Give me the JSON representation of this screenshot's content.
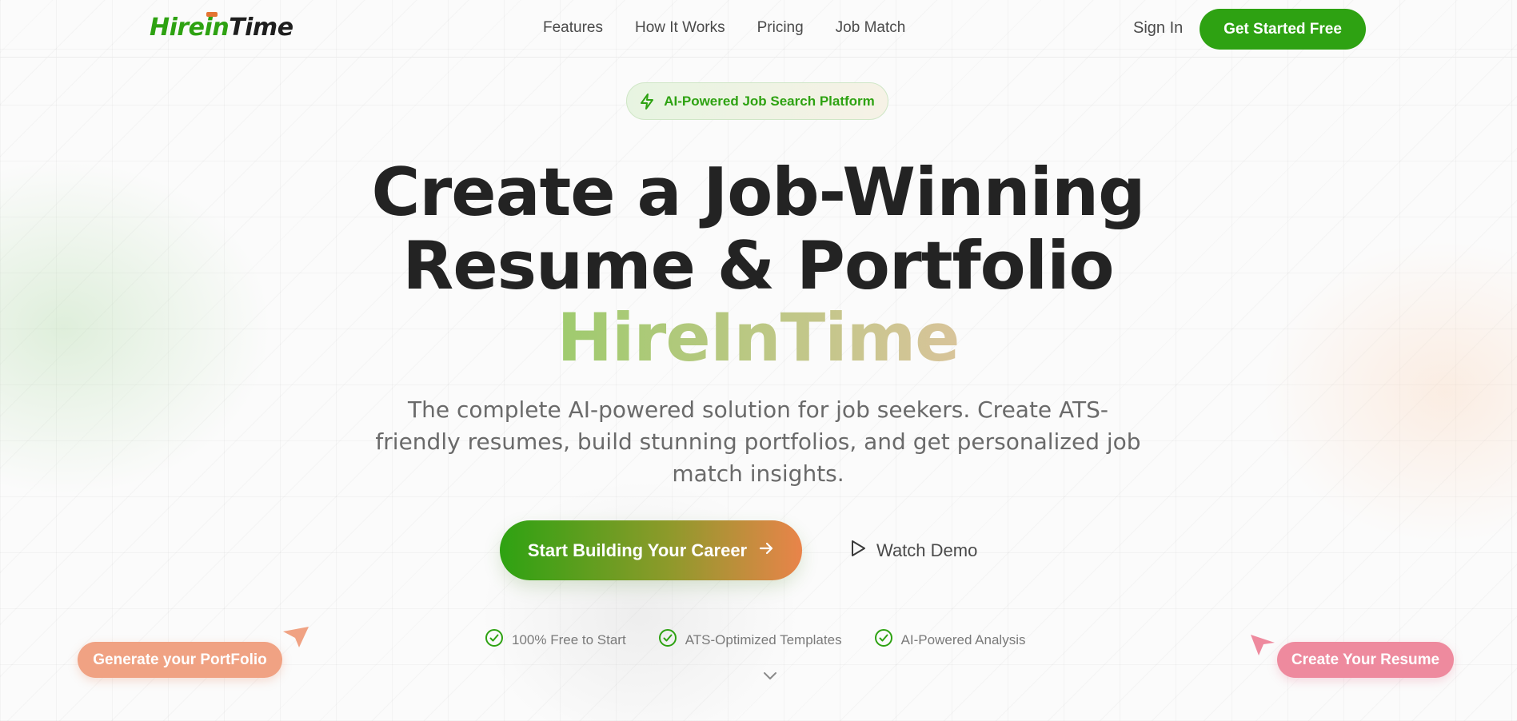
{
  "brand": {
    "logo_part1": "Hire",
    "logo_part2": "in",
    "logo_part3": "Time",
    "primary_color": "#2ea212",
    "accent_color": "#e47433"
  },
  "nav": {
    "links": [
      "Features",
      "How It Works",
      "Pricing",
      "Job Match"
    ],
    "sign_in": "Sign In",
    "get_started": "Get Started Free"
  },
  "hero": {
    "badge": {
      "icon": "lightning-icon",
      "text": "AI-Powered Job Search Platform"
    },
    "headline_line1": "Create a Job-Winning",
    "headline_line2": "Resume & Portfolio",
    "headline_brand": "HireInTime",
    "subtitle": "The complete AI-powered solution for job seekers. Create ATS-friendly resumes, build stunning portfolios, and get personalized job match insights.",
    "primary_cta": "Start Building Your Career",
    "secondary_cta": "Watch Demo"
  },
  "features": [
    {
      "icon": "check-circle-icon",
      "text": "100% Free to Start"
    },
    {
      "icon": "check-circle-icon",
      "text": "ATS-Optimized Templates"
    },
    {
      "icon": "check-circle-icon",
      "text": "AI-Powered Analysis"
    }
  ],
  "floating_tags": {
    "portfolio": "Generate your PortFolio",
    "resume": "Create Your Resume",
    "portfolio_color": "#f0a283",
    "resume_color": "#ee8a9e"
  }
}
